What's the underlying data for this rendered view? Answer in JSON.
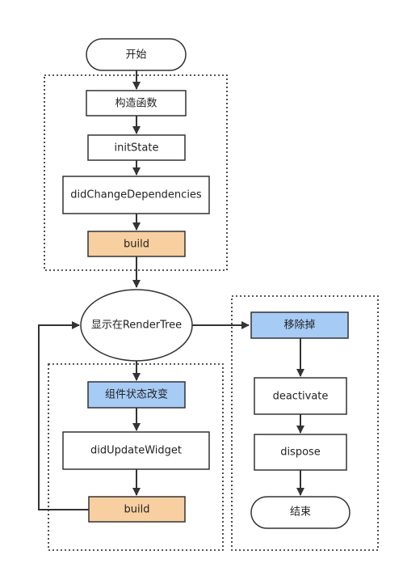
{
  "colors": {
    "default_fill": "#ffffff",
    "build_fill": "#f8cfa0",
    "highlight_fill": "#a6cbf5",
    "stroke": "#333333"
  },
  "nodes": {
    "start": "开始",
    "constructor": "构造函数",
    "init_state": "initState",
    "did_change_dependencies": "didChangeDependencies",
    "build_initial": "build",
    "render_tree": "显示在RenderTree",
    "state_change": "组件状态改变",
    "did_update_widget": "didUpdateWidget",
    "build_update": "build",
    "removed": "移除掉",
    "deactivate": "deactivate",
    "dispose": "dispose",
    "end": "结束"
  }
}
